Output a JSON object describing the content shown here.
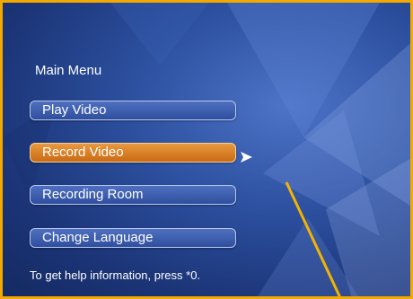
{
  "menu": {
    "title": "Main Menu",
    "items": [
      {
        "label": "Play Video",
        "selected": false
      },
      {
        "label": "Record Video",
        "selected": true
      },
      {
        "label": "Recording Room",
        "selected": false
      },
      {
        "label": "Change Language",
        "selected": false
      }
    ]
  },
  "help_text": "To get help information, press *0.",
  "colors": {
    "frame_border": "#f2a900",
    "selected_item": "#d97c24",
    "button": "#3f5fb0",
    "background": "#2c4f9e"
  }
}
